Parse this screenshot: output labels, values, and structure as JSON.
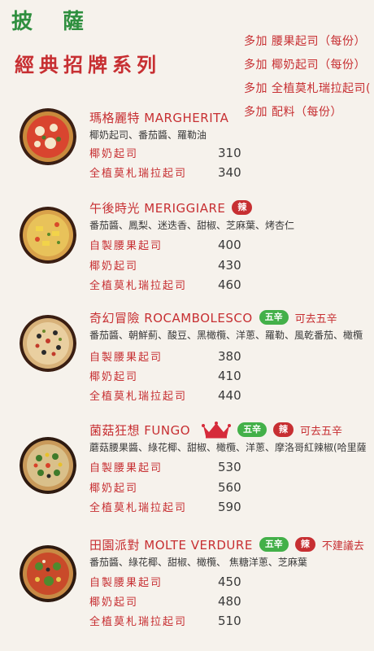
{
  "header": {
    "title": "披 薩",
    "subtitle": "經典招牌系列"
  },
  "addons": [
    "多加 腰果起司（每份）",
    "多加 椰奶起司（每份）",
    "多加 全植莫札瑞拉起司(",
    "多加 配料（每份）"
  ],
  "items": [
    {
      "name": "瑪格麗特 MARGHERITA",
      "description": "椰奶起司、番茄醬、羅勒油",
      "options": [
        {
          "label": "椰奶起司",
          "price": "310"
        },
        {
          "label": "全植莫札瑞拉起司",
          "price": "340"
        }
      ]
    },
    {
      "name": "午後時光 MERIGGIARE",
      "badges": [
        "辣"
      ],
      "description": "番茄醬、鳳梨、迷迭香、甜椒、芝麻葉、烤杏仁",
      "options": [
        {
          "label": "自製腰果起司",
          "price": "400"
        },
        {
          "label": "椰奶起司",
          "price": "430"
        },
        {
          "label": "全植莫札瑞拉起司",
          "price": "460"
        }
      ]
    },
    {
      "name": "奇幻冒險 ROCAMBOLESCO",
      "badges": [
        "五辛"
      ],
      "note": "可去五辛",
      "description": "番茄醬、朝鮮薊、酸豆、黑橄欖、洋蔥、羅勒、風乾番茄、橄欖",
      "options": [
        {
          "label": "自製腰果起司",
          "price": "380"
        },
        {
          "label": "椰奶起司",
          "price": "410"
        },
        {
          "label": "全植莫札瑞拉起司",
          "price": "440"
        }
      ]
    },
    {
      "name": "菌菇狂想 FUNGO",
      "crown": "crown-icon",
      "badges": [
        "五辛",
        "辣"
      ],
      "note": "可去五辛",
      "description": "蘑菇腰果醬、綠花椰、甜椒、橄欖、洋蔥、摩洛哥紅辣椒(哈里薩",
      "options": [
        {
          "label": "自製腰果起司",
          "price": "530"
        },
        {
          "label": "椰奶起司",
          "price": "560"
        },
        {
          "label": "全植莫札瑞拉起司",
          "price": "590"
        }
      ]
    },
    {
      "name": "田園派對 MOLTE VERDURE",
      "badges": [
        "五辛",
        "辣"
      ],
      "note": "不建議去",
      "description": "番茄醬、綠花椰、甜椒、橄欖、 焦糖洋蔥、芝麻葉",
      "options": [
        {
          "label": "自製腰果起司",
          "price": "450"
        },
        {
          "label": "椰奶起司",
          "price": "480"
        },
        {
          "label": "全植莫札瑞拉起司",
          "price": "510"
        }
      ]
    }
  ],
  "colors": {
    "background": "#f6f2ec",
    "title_green": "#2f8f3f",
    "accent_red": "#c72f32",
    "badge_green": "#43b049",
    "crown_red": "#d62b3b"
  }
}
